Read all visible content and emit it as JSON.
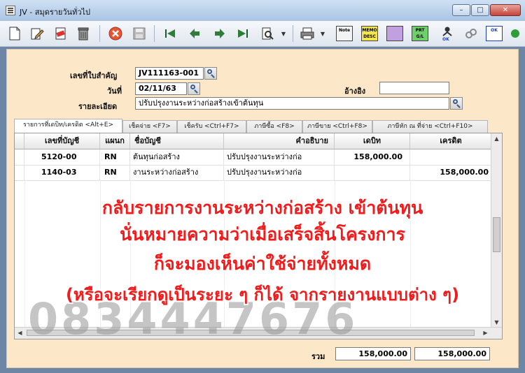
{
  "window": {
    "title": "JV - สมุดรายวันทั่วไป",
    "min_label": "–",
    "max_label": "□",
    "close_label": "✕"
  },
  "toolbar": {
    "note_label": "Note",
    "desc_label": "MEMO DESC",
    "gl_label": "PRT G/L",
    "ok_label": "OK",
    "ok2_label": "OK"
  },
  "form": {
    "doc_no_label": "เลขที่ใบสำคัญ",
    "doc_no_value": "JV111163-001",
    "date_label": "วันที่",
    "date_value": "02/11/63",
    "ref_label": "อ้างอิง",
    "ref_value": "",
    "detail_label": "รายละเอียด",
    "detail_value": "ปรับปรุงงานระหว่างก่อสร้างเข้าต้นทุน"
  },
  "tabs": [
    {
      "label": "รายการที่เดบิท/เครดิต <Alt+E>"
    },
    {
      "label": "เช็คจ่าย <F7>"
    },
    {
      "label": "เช็ครับ <Ctrl+F7>"
    },
    {
      "label": "ภาษีซื้อ <F8>"
    },
    {
      "label": "ภาษีขาย <Ctrl+F8>"
    },
    {
      "label": "ภาษีหัก ณ ที่จ่าย <Ctrl+F10>"
    }
  ],
  "grid": {
    "headers": [
      "เลขที่บัญชี",
      "แผนก",
      "ชื่อบัญชี",
      "คำอธิบาย",
      "เดบิท",
      "เครดิต"
    ],
    "rows": [
      [
        "5120-00",
        "RN",
        "ต้นทุนก่อสร้าง",
        "ปรับปรุงงานระหว่างก่อ",
        "158,000.00",
        ""
      ],
      [
        "1140-03",
        "RN",
        "งานระหว่างก่อสร้าง",
        "ปรับปรุงงานระหว่างก่อ",
        "",
        "158,000.00"
      ]
    ]
  },
  "totals": {
    "label": "รวม",
    "debit": "158,000.00",
    "credit": "158,000.00"
  },
  "overlay": {
    "line1": "กลับรายการงานระหว่างก่อสร้าง เข้าต้นทุน",
    "line2": "นั่นหมายความว่าเมื่อเสร็จสิ้นโครงการ",
    "line3": "ก็จะมองเห็นค่าใช้จ่ายทั้งหมด",
    "line4": "(หรือจะเรียกดูเป็นระยะ ๆ ก็ได้ จากรายงานแบบต่าง ๆ)",
    "watermark": "0834447676"
  }
}
